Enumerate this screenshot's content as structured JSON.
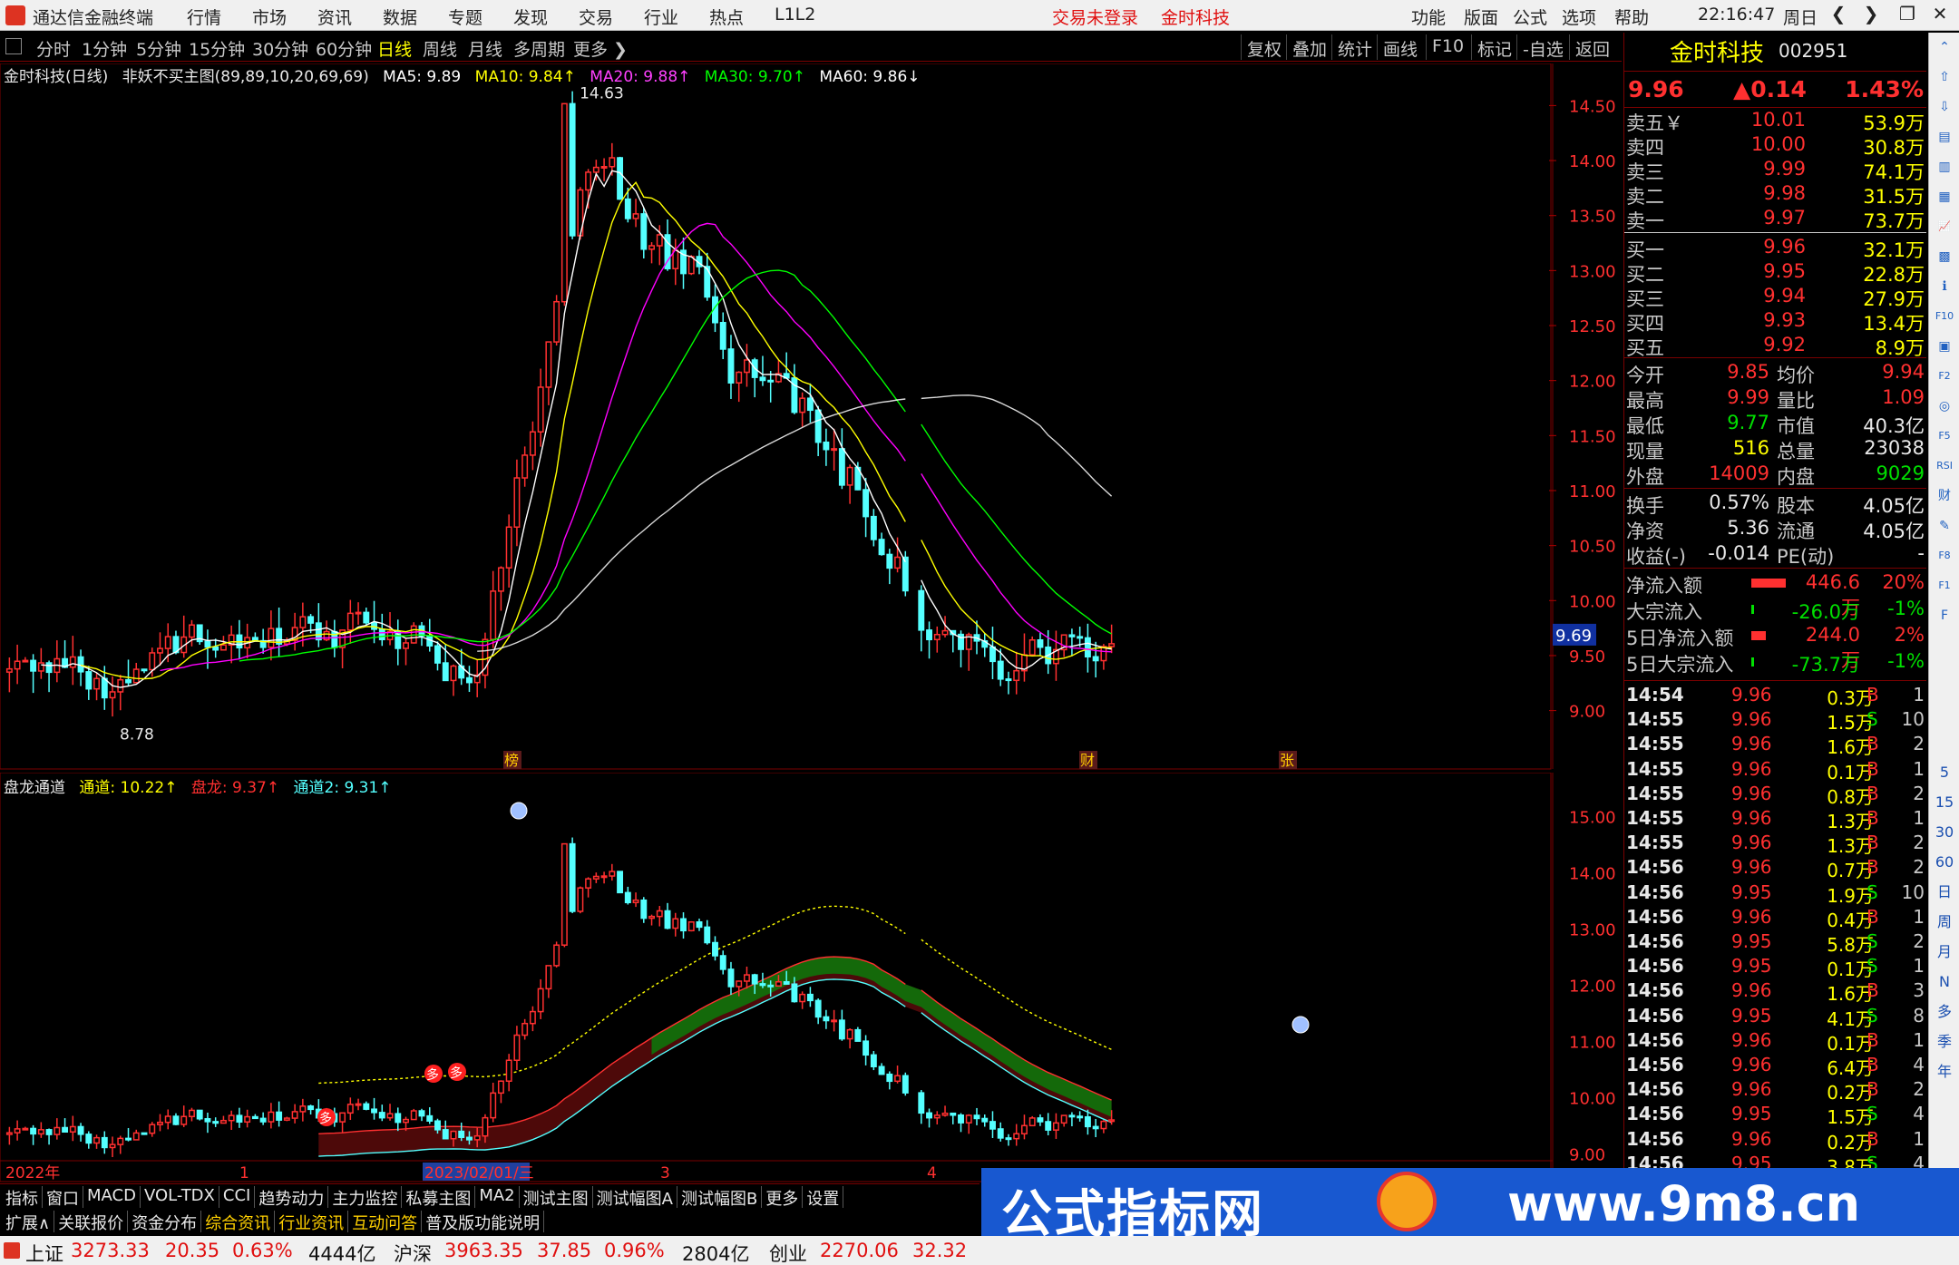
{
  "app": {
    "name": "通达信金融终端"
  },
  "topmenu": [
    "行情",
    "市场",
    "资讯",
    "数据",
    "专题",
    "发现",
    "交易",
    "行业",
    "热点",
    "L1L2"
  ],
  "status_login": "交易未登录",
  "status_stock": "金时科技",
  "sysmenu": [
    "功能",
    "版面",
    "公式",
    "选项",
    "帮助"
  ],
  "clock": {
    "time": "22:16:47",
    "day": "周日"
  },
  "window_buttons": [
    "❮",
    "❯",
    "❐",
    "✕"
  ],
  "periods": [
    "分时",
    "1分钟",
    "5分钟",
    "15分钟",
    "30分钟",
    "60分钟",
    "日线",
    "周线",
    "月线",
    "多周期",
    "更多 ❯"
  ],
  "active_period": "日线",
  "right_tools": [
    "复权",
    "叠加",
    "统计",
    "画线",
    "F10",
    "标记",
    "-自选",
    "返回"
  ],
  "main_legend": {
    "title": "金时科技(日线)",
    "formula": "非妖不买主图(89,89,10,20,69,69)",
    "ma5": "MA5: 9.89",
    "ma10": "MA10: 9.84↑",
    "ma20": "MA20: 9.88↑",
    "ma30": "MA30: 9.70↑",
    "ma60": "MA60: 9.86↓"
  },
  "sub_legend": {
    "title": "盘龙通道",
    "tongdao": "通道: 10.22↑",
    "panlong": "盘龙: 9.37↑",
    "tongdao2": "通道2: 9.31↑"
  },
  "main_axis": [
    "14.50",
    "14.00",
    "13.50",
    "13.00",
    "12.50",
    "12.00",
    "11.50",
    "11.00",
    "10.50",
    "10.00",
    "9.50",
    "9.00"
  ],
  "sub_axis": [
    "15.00",
    "14.00",
    "13.00",
    "12.00",
    "11.00",
    "10.00",
    "9.00"
  ],
  "annotations": {
    "high": "14.63",
    "low": "8.78",
    "current": "9.69",
    "bang": "榜",
    "cai": "财",
    "zhang": "张",
    "duo": "多"
  },
  "date_axis": {
    "year": "2022年",
    "m1": "1",
    "date": "2023/02/01/三",
    "m3": "3",
    "m4": "4"
  },
  "tabs1": [
    "指标",
    "窗口",
    "MACD",
    "VOL-TDX",
    "CCI",
    "趋势动力",
    "主力监控",
    "私募主图",
    "MA2",
    "测试主图",
    "测试幅图A",
    "测试幅图B",
    "更多",
    "设置"
  ],
  "tabs2": [
    "扩展∧",
    "关联报价",
    "资金分布",
    "综合资讯",
    "行业资讯",
    "互动问答",
    "普及版功能说明"
  ],
  "statusbar": {
    "sh_label": "上证",
    "sh_val": "3273.33",
    "sh_chg": "20.35",
    "sh_pct": "0.63%",
    "sh_amt": "4444亿",
    "sz_label": "沪深",
    "sz_val": "3963.35",
    "sz_chg": "37.85",
    "sz_pct": "0.96%",
    "sz_amt": "2804亿",
    "cy_label": "创业",
    "cy_val": "2270.06",
    "cy_chg": "32.32"
  },
  "quote": {
    "name": "金时科技",
    "code": "002951",
    "price": "9.96",
    "change": "▲0.14",
    "pct": "1.43%",
    "asks": [
      {
        "label": "卖五￥",
        "price": "10.01",
        "vol": "53.9万"
      },
      {
        "label": "卖四",
        "price": "10.00",
        "vol": "30.8万"
      },
      {
        "label": "卖三",
        "price": "9.99",
        "vol": "74.1万"
      },
      {
        "label": "卖二",
        "price": "9.98",
        "vol": "31.5万"
      },
      {
        "label": "卖一",
        "price": "9.97",
        "vol": "73.7万"
      }
    ],
    "bids": [
      {
        "label": "买一",
        "price": "9.96",
        "vol": "32.1万"
      },
      {
        "label": "买二",
        "price": "9.95",
        "vol": "22.8万"
      },
      {
        "label": "买三",
        "price": "9.94",
        "vol": "27.9万"
      },
      {
        "label": "买四",
        "price": "9.93",
        "vol": "13.4万"
      },
      {
        "label": "买五",
        "price": "9.92",
        "vol": "8.9万"
      }
    ],
    "stats": [
      {
        "l1": "今开",
        "v1": "9.85",
        "c1": "red",
        "l2": "均价",
        "v2": "9.94",
        "c2": "red"
      },
      {
        "l1": "最高",
        "v1": "9.99",
        "c1": "red",
        "l2": "量比",
        "v2": "1.09",
        "c2": "red"
      },
      {
        "l1": "最低",
        "v1": "9.77",
        "c1": "green",
        "l2": "市值",
        "v2": "40.3亿",
        "c2": "white"
      },
      {
        "l1": "现量",
        "v1": "516",
        "c1": "yellow",
        "l2": "总量",
        "v2": "23038",
        "c2": "white"
      },
      {
        "l1": "外盘",
        "v1": "14009",
        "c1": "red",
        "l2": "内盘",
        "v2": "9029",
        "c2": "green"
      }
    ],
    "stats2": [
      {
        "l1": "换手",
        "v1": "0.57%",
        "l2": "股本",
        "v2": "4.05亿"
      },
      {
        "l1": "净资",
        "v1": "5.36",
        "l2": "流通",
        "v2": "4.05亿"
      },
      {
        "l1": "收益(-)",
        "v1": "-0.014",
        "l2": "PE(动)",
        "v2": "-"
      }
    ],
    "flows": [
      {
        "label": "净流入额",
        "val": "446.6万",
        "pct": "20%",
        "color": "red"
      },
      {
        "label": "大宗流入",
        "val": "-26.0万",
        "pct": "-1%",
        "color": "green"
      },
      {
        "label": "5日净流入额",
        "val": "244.0万",
        "pct": "2%",
        "color": "red"
      },
      {
        "label": "5日大宗流入",
        "val": "-73.7万",
        "pct": "-1%",
        "color": "green"
      }
    ],
    "ticks": [
      {
        "t": "14:54",
        "p": "9.96",
        "v": "0.3万",
        "bs": "B",
        "n": "1"
      },
      {
        "t": "14:55",
        "p": "9.96",
        "v": "1.5万",
        "bs": "S",
        "n": "10"
      },
      {
        "t": "14:55",
        "p": "9.96",
        "v": "1.6万",
        "bs": "B",
        "n": "2"
      },
      {
        "t": "14:55",
        "p": "9.96",
        "v": "0.1万",
        "bs": "B",
        "n": "1"
      },
      {
        "t": "14:55",
        "p": "9.96",
        "v": "0.8万",
        "bs": "B",
        "n": "2"
      },
      {
        "t": "14:55",
        "p": "9.96",
        "v": "1.3万",
        "bs": "B",
        "n": "1"
      },
      {
        "t": "14:55",
        "p": "9.96",
        "v": "1.3万",
        "bs": "B",
        "n": "2"
      },
      {
        "t": "14:56",
        "p": "9.96",
        "v": "0.7万",
        "bs": "B",
        "n": "2"
      },
      {
        "t": "14:56",
        "p": "9.95",
        "v": "1.9万",
        "bs": "S",
        "n": "10"
      },
      {
        "t": "14:56",
        "p": "9.96",
        "v": "0.4万",
        "bs": "B",
        "n": "1"
      },
      {
        "t": "14:56",
        "p": "9.95",
        "v": "5.8万",
        "bs": "S",
        "n": "2"
      },
      {
        "t": "14:56",
        "p": "9.95",
        "v": "0.1万",
        "bs": "S",
        "n": "1"
      },
      {
        "t": "14:56",
        "p": "9.96",
        "v": "1.6万",
        "bs": "B",
        "n": "3"
      },
      {
        "t": "14:56",
        "p": "9.95",
        "v": "4.1万",
        "bs": "S",
        "n": "8"
      },
      {
        "t": "14:56",
        "p": "9.96",
        "v": "0.1万",
        "bs": "B",
        "n": "1"
      },
      {
        "t": "14:56",
        "p": "9.96",
        "v": "6.4万",
        "bs": "B",
        "n": "4"
      },
      {
        "t": "14:56",
        "p": "9.96",
        "v": "0.2万",
        "bs": "B",
        "n": "2"
      },
      {
        "t": "14:56",
        "p": "9.95",
        "v": "1.5万",
        "bs": "S",
        "n": "4"
      },
      {
        "t": "14:56",
        "p": "9.96",
        "v": "0.2万",
        "bs": "B",
        "n": "1"
      },
      {
        "t": "14:56",
        "p": "9.95",
        "v": "3.8万",
        "bs": "S",
        "n": "4"
      }
    ]
  },
  "icon_names": [
    "expand-icon",
    "up-icon",
    "down-icon",
    "minute-chart-icon",
    "kline-icon",
    "table-icon",
    "line-chart-icon",
    "bar-icon",
    "info-icon",
    "f10-icon",
    "doc-icon",
    "f2-icon",
    "circle-icon",
    "f5-icon",
    "rsi-icon",
    "finance-icon",
    "pen-icon",
    "f8-icon",
    "f1-icon",
    "f-icon"
  ],
  "icon_tools": [
    "⌃",
    "⇧",
    "⇩",
    "▤",
    "▥",
    "▦",
    "📈",
    "▩",
    "ℹ",
    "F10",
    "▣",
    "F2",
    "◎",
    "F5",
    "RSI",
    "财",
    "✎",
    "F8",
    "F1",
    "F"
  ],
  "icon_periods": [
    "5",
    "15",
    "30",
    "60",
    "日",
    "周",
    "月",
    "N",
    "多",
    "季",
    "年"
  ],
  "banner": {
    "title": "公式指标网",
    "url": "www.9m8.cn"
  },
  "colors": {
    "up": "#ff3030",
    "down": "#54ffff",
    "ma5": "#ffffff",
    "ma10": "#ffff00",
    "ma20": "#ff00ff",
    "ma30": "#00ff00",
    "ma60": "#ffffff"
  },
  "chart_data": {
    "type": "candlestick",
    "main_range": [
      8.7,
      14.8
    ],
    "sub_range": [
      8.85,
      15.3
    ],
    "segments": [
      {
        "start_price": 9.35,
        "n": 60,
        "mode": "range",
        "hi": 9.95,
        "lo": 9.0
      },
      {
        "n": 14,
        "mode": "rally",
        "to": 14.0
      },
      {
        "n": 40,
        "mode": "decline",
        "to": 10.2
      },
      {
        "n": 0,
        "mode": "gap"
      },
      {
        "n": 25,
        "mode": "range2",
        "hi": 9.75,
        "lo": 9.2
      }
    ]
  }
}
